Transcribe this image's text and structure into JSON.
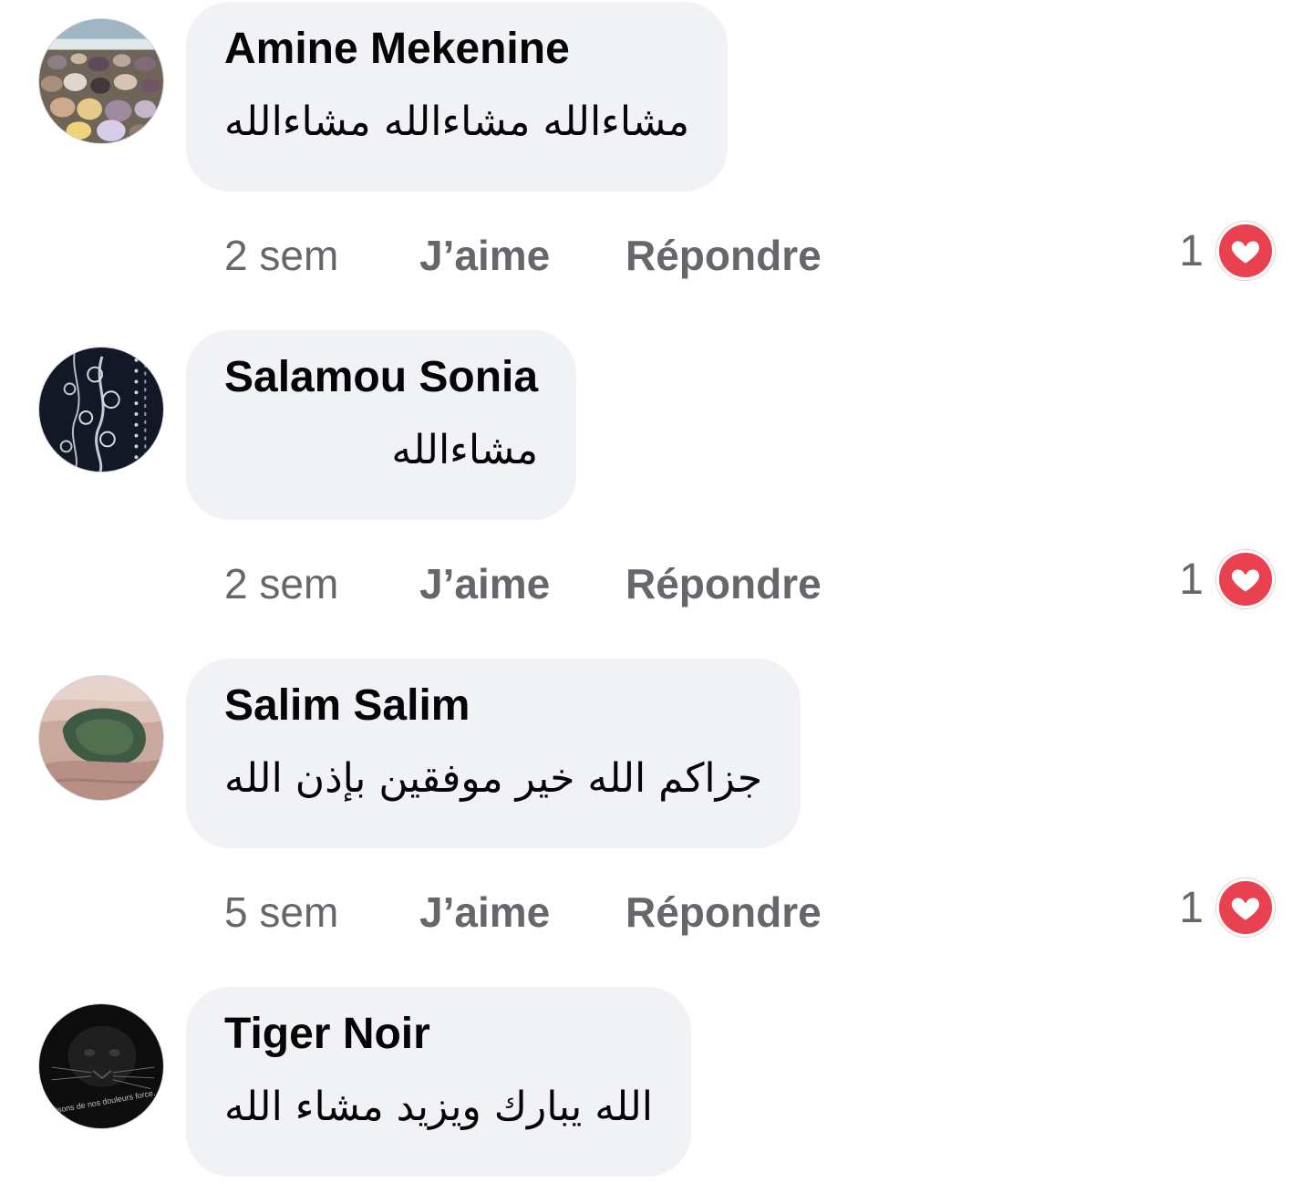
{
  "comments": [
    {
      "author": "Amine Mekenine",
      "text": "مشاءالله مشاءالله مشاءالله",
      "time": "2 sem",
      "like_label": "J’aime",
      "reply_label": "Répondre",
      "reaction_count": "1",
      "reaction_icon": "love-icon",
      "avatar": "pebbles-avatar"
    },
    {
      "author": "Salamou Sonia",
      "text": "مشاءالله",
      "time": "2 sem",
      "like_label": "J’aime",
      "reply_label": "Répondre",
      "reaction_count": "1",
      "reaction_icon": "love-icon",
      "avatar": "floral-pattern-avatar"
    },
    {
      "author": "Salim Salim",
      "text": "جزاكم الله خير موفقين بإذن الله",
      "time": "5 sem",
      "like_label": "J’aime",
      "reply_label": "Répondre",
      "reaction_count": "1",
      "reaction_icon": "love-icon",
      "avatar": "desert-oasis-avatar"
    },
    {
      "author": "Tiger Noir",
      "text": "الله يبارك ويزيد مشاء الله",
      "avatar": "black-panther-avatar",
      "avatar_caption": "Faisons de nos douleurs force."
    }
  ],
  "colors": {
    "bubble": "#f0f2f5",
    "meta_text": "#65676b",
    "love_reaction": "#e9414f"
  }
}
